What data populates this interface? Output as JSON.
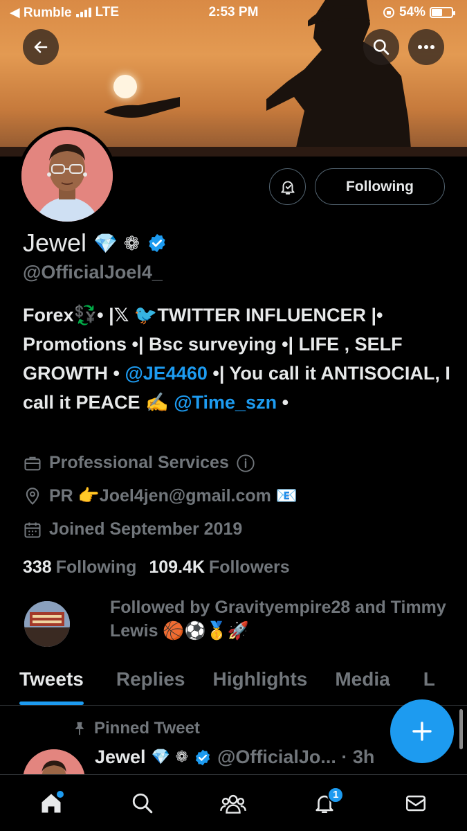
{
  "status_bar": {
    "carrier": "◀ Rumble",
    "network": "LTE",
    "time": "2:53 PM",
    "battery": "54%",
    "battery_level": 0.54
  },
  "profile": {
    "name": "Jewel",
    "name_emojis": "💎 ❁",
    "handle": "@OfficialJoel4_",
    "follow_label": "Following",
    "bio": {
      "part1": "Forex💱• |𝕏 🐦TWITTER INFLUENCER |• Promotions •| Bsc surveying •| LIFE , SELF GROWTH • ",
      "mention1": "@JE4460",
      "part2": " •| You call it ANTISOCIAL, I call it PEACE ✍️ ",
      "mention2": "@Time_szn",
      "part3": " •"
    },
    "category": "Professional Services",
    "location": "PR 👉Joel4jen@gmail.com 📧",
    "joined": "Joined September 2019",
    "following_count": "338",
    "following_label": "Following",
    "followers_count": "109.4K",
    "followers_label": "Followers",
    "followed_by": "Followed by Gravityempire28 and Timmy Lewis 🏀⚽🥇🚀"
  },
  "tabs": [
    "Tweets",
    "Replies",
    "Highlights",
    "Media",
    "L"
  ],
  "pinned": {
    "label": "Pinned Tweet",
    "author": "Jewel",
    "author_emojis": "💎 ❁",
    "handle_time": "@OfficialJo... · 3h"
  },
  "bottom_nav": {
    "notifications_badge": "1"
  },
  "colors": {
    "accent": "#1d9bf0",
    "muted": "#71767b",
    "text": "#e7e9ea",
    "background": "#000000"
  },
  "icons": [
    "back-arrow-icon",
    "search-icon",
    "more-icon",
    "notification-bell-icon",
    "verified-badge-icon",
    "briefcase-icon",
    "info-icon",
    "location-pin-icon",
    "calendar-icon",
    "pin-icon",
    "plus-icon",
    "home-icon",
    "communities-icon",
    "mail-icon"
  ]
}
